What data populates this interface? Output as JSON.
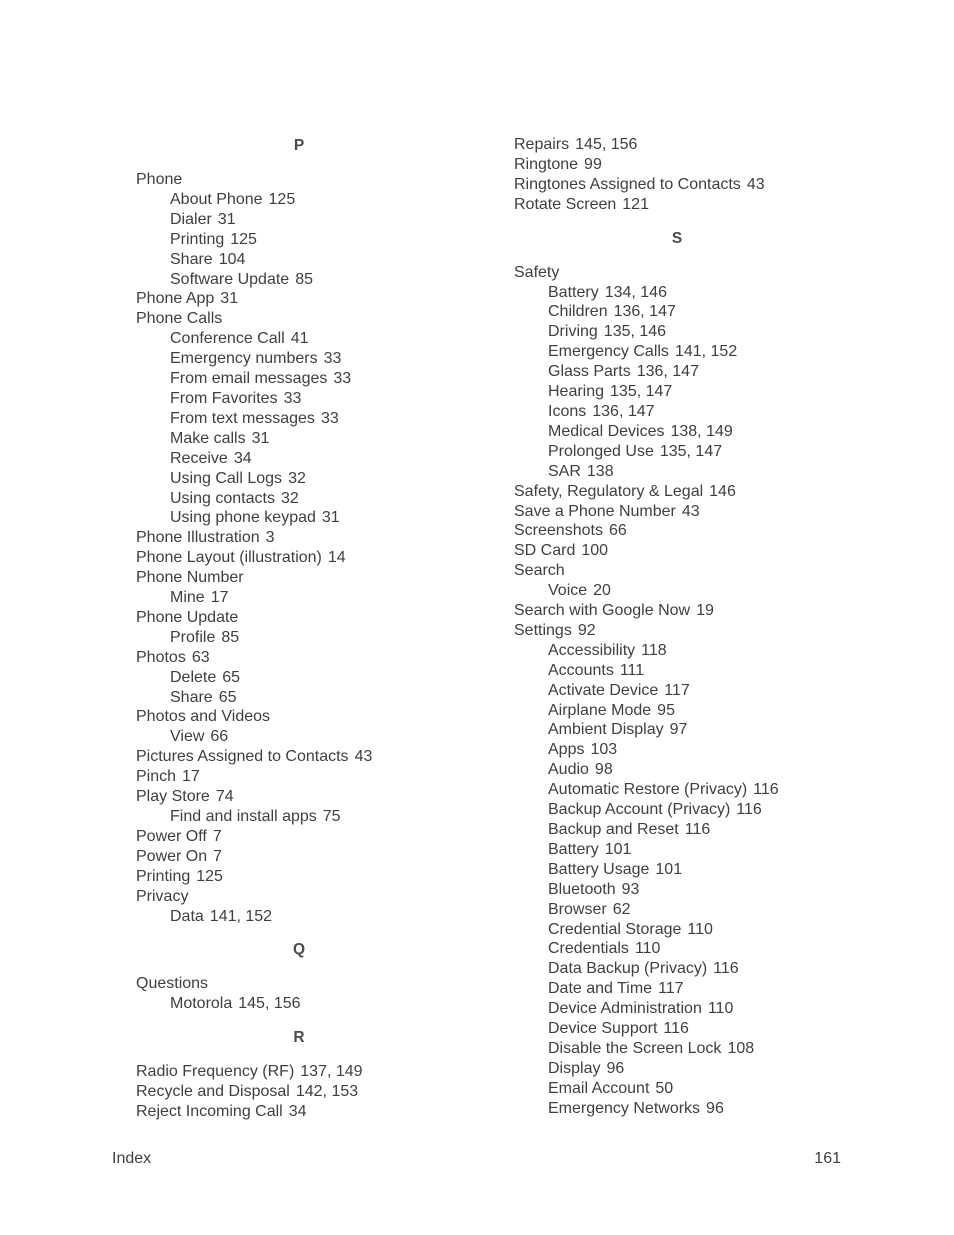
{
  "left_column": [
    {
      "type": "letter",
      "text": "P"
    },
    {
      "type": "entry",
      "level": 0,
      "term": "Phone",
      "pages": ""
    },
    {
      "type": "entry",
      "level": 1,
      "term": "About Phone",
      "pages": "125"
    },
    {
      "type": "entry",
      "level": 1,
      "term": "Dialer",
      "pages": "31"
    },
    {
      "type": "entry",
      "level": 1,
      "term": "Printing",
      "pages": "125"
    },
    {
      "type": "entry",
      "level": 1,
      "term": "Share",
      "pages": "104"
    },
    {
      "type": "entry",
      "level": 1,
      "term": "Software Update",
      "pages": "85"
    },
    {
      "type": "entry",
      "level": 0,
      "term": "Phone App",
      "pages": "31"
    },
    {
      "type": "entry",
      "level": 0,
      "term": "Phone Calls",
      "pages": ""
    },
    {
      "type": "entry",
      "level": 1,
      "term": "Conference Call",
      "pages": "41"
    },
    {
      "type": "entry",
      "level": 1,
      "term": "Emergency numbers",
      "pages": "33"
    },
    {
      "type": "entry",
      "level": 1,
      "term": "From email messages",
      "pages": "33"
    },
    {
      "type": "entry",
      "level": 1,
      "term": "From Favorites",
      "pages": "33"
    },
    {
      "type": "entry",
      "level": 1,
      "term": "From text messages",
      "pages": "33"
    },
    {
      "type": "entry",
      "level": 1,
      "term": "Make calls",
      "pages": "31"
    },
    {
      "type": "entry",
      "level": 1,
      "term": "Receive",
      "pages": "34"
    },
    {
      "type": "entry",
      "level": 1,
      "term": "Using Call Logs",
      "pages": "32"
    },
    {
      "type": "entry",
      "level": 1,
      "term": "Using contacts",
      "pages": "32"
    },
    {
      "type": "entry",
      "level": 1,
      "term": "Using phone keypad",
      "pages": "31"
    },
    {
      "type": "entry",
      "level": 0,
      "term": "Phone Illustration",
      "pages": "3"
    },
    {
      "type": "entry",
      "level": 0,
      "term": "Phone Layout (illustration)",
      "pages": "14"
    },
    {
      "type": "entry",
      "level": 0,
      "term": "Phone Number",
      "pages": ""
    },
    {
      "type": "entry",
      "level": 1,
      "term": "Mine",
      "pages": "17"
    },
    {
      "type": "entry",
      "level": 0,
      "term": "Phone Update",
      "pages": ""
    },
    {
      "type": "entry",
      "level": 1,
      "term": "Profile",
      "pages": "85"
    },
    {
      "type": "entry",
      "level": 0,
      "term": "Photos",
      "pages": "63"
    },
    {
      "type": "entry",
      "level": 1,
      "term": "Delete",
      "pages": "65"
    },
    {
      "type": "entry",
      "level": 1,
      "term": "Share",
      "pages": "65"
    },
    {
      "type": "entry",
      "level": 0,
      "term": "Photos and Videos",
      "pages": ""
    },
    {
      "type": "entry",
      "level": 1,
      "term": "View",
      "pages": "66"
    },
    {
      "type": "entry",
      "level": 0,
      "term": "Pictures Assigned to Contacts",
      "pages": "43"
    },
    {
      "type": "entry",
      "level": 0,
      "term": "Pinch",
      "pages": "17"
    },
    {
      "type": "entry",
      "level": 0,
      "term": "Play Store",
      "pages": "74"
    },
    {
      "type": "entry",
      "level": 1,
      "term": "Find and install apps",
      "pages": "75"
    },
    {
      "type": "entry",
      "level": 0,
      "term": "Power Off",
      "pages": "7"
    },
    {
      "type": "entry",
      "level": 0,
      "term": "Power On",
      "pages": "7"
    },
    {
      "type": "entry",
      "level": 0,
      "term": "Printing",
      "pages": "125"
    },
    {
      "type": "entry",
      "level": 0,
      "term": "Privacy",
      "pages": ""
    },
    {
      "type": "entry",
      "level": 1,
      "term": "Data",
      "pages": "141, 152"
    },
    {
      "type": "letter",
      "text": "Q"
    },
    {
      "type": "entry",
      "level": 0,
      "term": "Questions",
      "pages": ""
    },
    {
      "type": "entry",
      "level": 1,
      "term": "Motorola",
      "pages": "145, 156"
    },
    {
      "type": "letter",
      "text": "R"
    },
    {
      "type": "entry",
      "level": 0,
      "term": "Radio Frequency (RF)",
      "pages": "137, 149"
    },
    {
      "type": "entry",
      "level": 0,
      "term": "Recycle and Disposal",
      "pages": "142, 153"
    },
    {
      "type": "entry",
      "level": 0,
      "term": "Reject Incoming Call",
      "pages": "34"
    }
  ],
  "right_column": [
    {
      "type": "entry",
      "level": 0,
      "term": "Repairs",
      "pages": "145, 156"
    },
    {
      "type": "entry",
      "level": 0,
      "term": "Ringtone",
      "pages": "99"
    },
    {
      "type": "entry",
      "level": 0,
      "term": "Ringtones Assigned to Contacts",
      "pages": "43"
    },
    {
      "type": "entry",
      "level": 0,
      "term": "Rotate Screen",
      "pages": "121"
    },
    {
      "type": "letter",
      "text": "S"
    },
    {
      "type": "entry",
      "level": 0,
      "term": "Safety",
      "pages": ""
    },
    {
      "type": "entry",
      "level": 1,
      "term": "Battery",
      "pages": "134, 146"
    },
    {
      "type": "entry",
      "level": 1,
      "term": "Children",
      "pages": "136, 147"
    },
    {
      "type": "entry",
      "level": 1,
      "term": "Driving",
      "pages": "135, 146"
    },
    {
      "type": "entry",
      "level": 1,
      "term": "Emergency Calls",
      "pages": "141, 152"
    },
    {
      "type": "entry",
      "level": 1,
      "term": "Glass Parts",
      "pages": "136, 147"
    },
    {
      "type": "entry",
      "level": 1,
      "term": "Hearing",
      "pages": "135, 147"
    },
    {
      "type": "entry",
      "level": 1,
      "term": "Icons",
      "pages": "136, 147"
    },
    {
      "type": "entry",
      "level": 1,
      "term": "Medical Devices",
      "pages": "138, 149"
    },
    {
      "type": "entry",
      "level": 1,
      "term": "Prolonged Use",
      "pages": "135, 147"
    },
    {
      "type": "entry",
      "level": 1,
      "term": "SAR",
      "pages": "138"
    },
    {
      "type": "entry",
      "level": 0,
      "term": "Safety, Regulatory & Legal",
      "pages": "146"
    },
    {
      "type": "entry",
      "level": 0,
      "term": "Save a Phone Number",
      "pages": "43"
    },
    {
      "type": "entry",
      "level": 0,
      "term": "Screenshots",
      "pages": "66"
    },
    {
      "type": "entry",
      "level": 0,
      "term": "SD Card",
      "pages": "100"
    },
    {
      "type": "entry",
      "level": 0,
      "term": "Search",
      "pages": ""
    },
    {
      "type": "entry",
      "level": 1,
      "term": "Voice",
      "pages": "20"
    },
    {
      "type": "entry",
      "level": 0,
      "term": "Search with Google Now",
      "pages": "19"
    },
    {
      "type": "entry",
      "level": 0,
      "term": "Settings",
      "pages": "92"
    },
    {
      "type": "entry",
      "level": 1,
      "term": "Accessibility",
      "pages": "118"
    },
    {
      "type": "entry",
      "level": 1,
      "term": "Accounts",
      "pages": "111"
    },
    {
      "type": "entry",
      "level": 1,
      "term": "Activate Device",
      "pages": "117"
    },
    {
      "type": "entry",
      "level": 1,
      "term": "Airplane Mode",
      "pages": "95"
    },
    {
      "type": "entry",
      "level": 1,
      "term": "Ambient Display",
      "pages": "97"
    },
    {
      "type": "entry",
      "level": 1,
      "term": "Apps",
      "pages": "103"
    },
    {
      "type": "entry",
      "level": 1,
      "term": "Audio",
      "pages": "98"
    },
    {
      "type": "entry",
      "level": 1,
      "term": "Automatic Restore (Privacy)",
      "pages": "116"
    },
    {
      "type": "entry",
      "level": 1,
      "term": "Backup Account (Privacy)",
      "pages": "116"
    },
    {
      "type": "entry",
      "level": 1,
      "term": "Backup and Reset",
      "pages": "116"
    },
    {
      "type": "entry",
      "level": 1,
      "term": "Battery",
      "pages": "101"
    },
    {
      "type": "entry",
      "level": 1,
      "term": "Battery Usage",
      "pages": "101"
    },
    {
      "type": "entry",
      "level": 1,
      "term": "Bluetooth",
      "pages": "93"
    },
    {
      "type": "entry",
      "level": 1,
      "term": "Browser",
      "pages": "62"
    },
    {
      "type": "entry",
      "level": 1,
      "term": "Credential Storage",
      "pages": "110"
    },
    {
      "type": "entry",
      "level": 1,
      "term": "Credentials",
      "pages": "110"
    },
    {
      "type": "entry",
      "level": 1,
      "term": "Data Backup (Privacy)",
      "pages": "116"
    },
    {
      "type": "entry",
      "level": 1,
      "term": "Date and Time",
      "pages": "117"
    },
    {
      "type": "entry",
      "level": 1,
      "term": "Device Administration",
      "pages": "110"
    },
    {
      "type": "entry",
      "level": 1,
      "term": "Device Support",
      "pages": "116"
    },
    {
      "type": "entry",
      "level": 1,
      "term": "Disable the Screen Lock",
      "pages": "108"
    },
    {
      "type": "entry",
      "level": 1,
      "term": "Display",
      "pages": "96"
    },
    {
      "type": "entry",
      "level": 1,
      "term": "Email Account",
      "pages": "50"
    },
    {
      "type": "entry",
      "level": 1,
      "term": "Emergency Networks",
      "pages": "96"
    }
  ],
  "footer": {
    "section": "Index",
    "page_number": "161"
  }
}
